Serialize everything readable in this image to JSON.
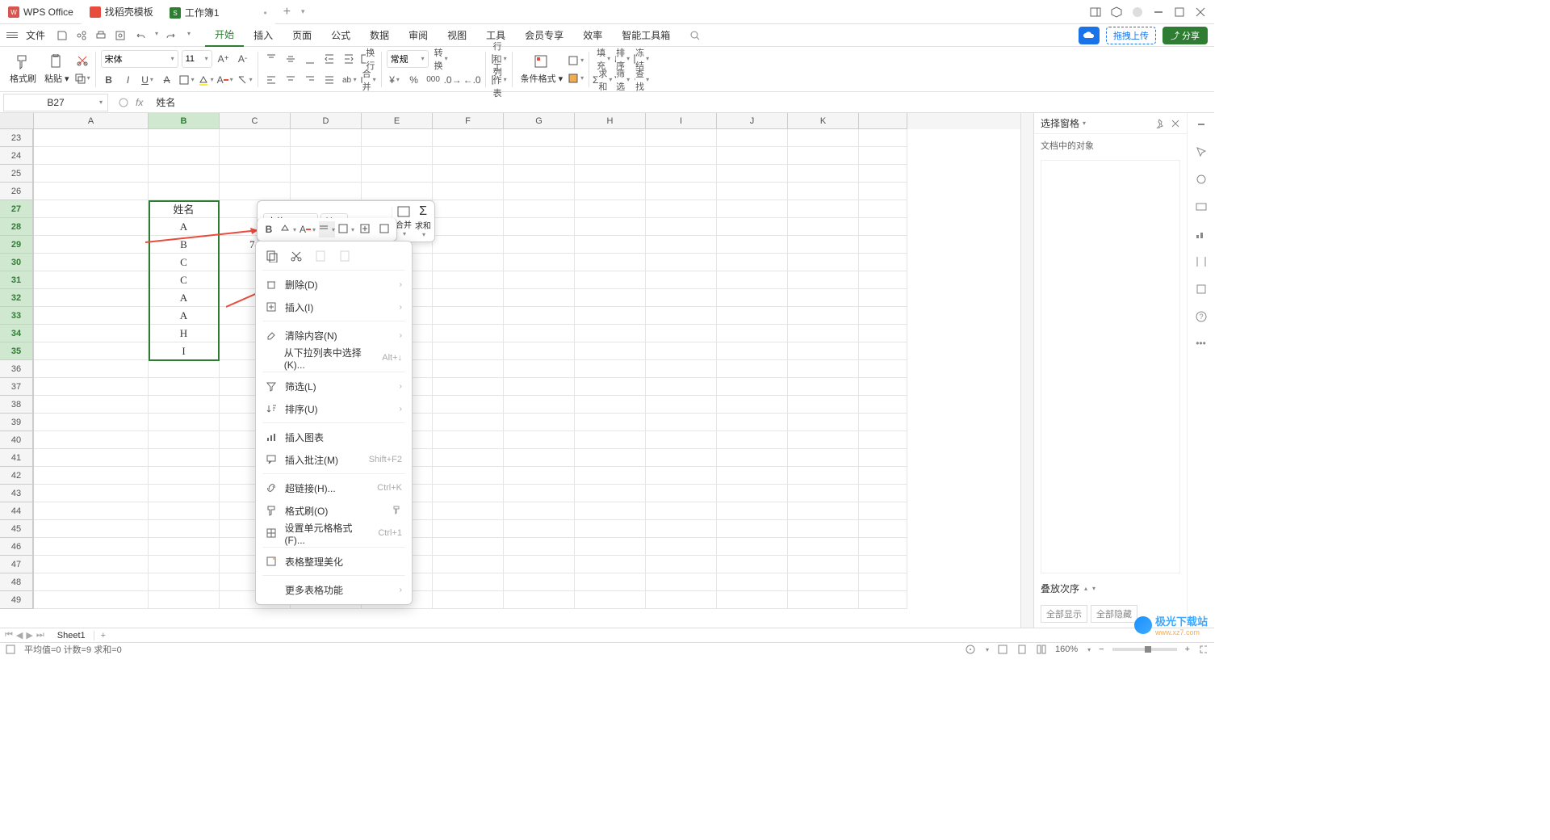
{
  "titlebar": {
    "brand": "WPS Office",
    "template": "找稻壳模板",
    "workbook": "工作簿1"
  },
  "menubar": {
    "file": "文件",
    "tabs": [
      "开始",
      "插入",
      "页面",
      "公式",
      "数据",
      "审阅",
      "视图",
      "工具",
      "会员专享",
      "效率",
      "智能工具箱"
    ],
    "upload": "拖拽上传",
    "share": "分享"
  },
  "ribbon": {
    "format_painter": "格式刷",
    "paste": "粘贴",
    "font_name": "宋体",
    "font_size": "11",
    "wrap": "换行",
    "merge": "合并",
    "number_format": "常规",
    "convert": "转换",
    "rowcol": "行和列",
    "worksheet": "工作表",
    "cond_format": "条件格式",
    "fill": "填充",
    "sort": "排序",
    "freeze": "冻结",
    "sum": "求和",
    "filter": "筛选",
    "find": "查找"
  },
  "formula_bar": {
    "name_box": "B27",
    "formula": "姓名"
  },
  "columns": [
    "A",
    "B",
    "C",
    "D",
    "E",
    "F",
    "G",
    "H",
    "I",
    "J",
    "K"
  ],
  "rows": [
    23,
    24,
    25,
    26,
    27,
    28,
    29,
    30,
    31,
    32,
    33,
    34,
    35,
    36,
    37,
    38,
    39,
    40,
    41,
    42,
    43,
    44,
    45,
    46,
    47,
    48,
    49
  ],
  "cells": {
    "B27": "姓名",
    "B28": "A",
    "B29": "B",
    "B30": "C",
    "B31": "C",
    "B32": "A",
    "B33": "A",
    "B34": "H",
    "B35": "I",
    "C29": "74"
  },
  "mini_toolbar": {
    "font": "宋体",
    "size": "11",
    "merge": "合并",
    "sum": "求和"
  },
  "context_menu": {
    "delete": "删除(D)",
    "insert": "插入(I)",
    "clear": "清除内容(N)",
    "dropdown_list": "从下拉列表中选择(K)...",
    "dropdown_short": "Alt+↓",
    "filter": "筛选(L)",
    "sort": "排序(U)",
    "insert_chart": "插入图表",
    "insert_comment": "插入批注(M)",
    "comment_short": "Shift+F2",
    "hyperlink": "超链接(H)...",
    "hyperlink_short": "Ctrl+K",
    "format_painter": "格式刷(O)",
    "cell_format": "设置单元格格式(F)...",
    "cell_format_short": "Ctrl+1",
    "beautify": "表格整理美化",
    "more": "更多表格功能"
  },
  "right_panel": {
    "title": "选择窗格",
    "sub": "文档中的对象",
    "stack": "叠放次序",
    "show_all": "全部显示",
    "hide_all": "全部隐藏"
  },
  "sheet_tabs": {
    "sheet1": "Sheet1"
  },
  "status_bar": {
    "stats": "平均值=0  计数=9  求和=0",
    "zoom": "160%"
  },
  "watermark": {
    "text": "极光下载站",
    "url": "www.xz7.com"
  },
  "chart_data": null
}
